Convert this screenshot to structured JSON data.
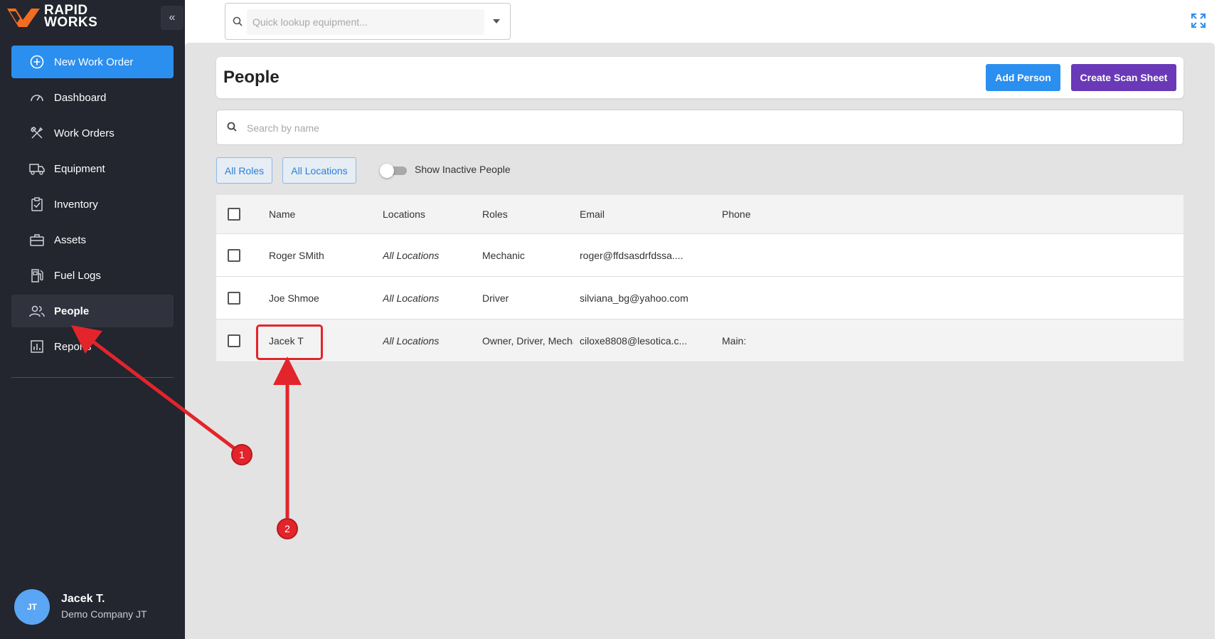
{
  "brand": {
    "line1": "RAPID",
    "line2": "WORKS",
    "accent": "#f26d21"
  },
  "sidebar": {
    "collapse_icon": "«",
    "new_work_order": "New Work Order",
    "items": [
      {
        "label": "Dashboard",
        "icon": "gauge-icon"
      },
      {
        "label": "Work Orders",
        "icon": "tools-icon"
      },
      {
        "label": "Equipment",
        "icon": "truck-icon"
      },
      {
        "label": "Inventory",
        "icon": "clipboard-check-icon"
      },
      {
        "label": "Assets",
        "icon": "briefcase-icon"
      },
      {
        "label": "Fuel Logs",
        "icon": "fuel-pump-icon"
      },
      {
        "label": "People",
        "icon": "people-icon",
        "active": true
      },
      {
        "label": "Reports",
        "icon": "chart-icon"
      }
    ],
    "user": {
      "initials": "JT",
      "name": "Jacek T.",
      "company": "Demo Company JT"
    }
  },
  "topbar": {
    "lookup_placeholder": "Quick lookup equipment..."
  },
  "page": {
    "title": "People",
    "add_person": "Add Person",
    "create_scan_sheet": "Create Scan Sheet",
    "search_placeholder": "Search by name",
    "filters": {
      "roles": "All Roles",
      "locations": "All Locations",
      "show_inactive": "Show Inactive People",
      "show_inactive_on": false
    }
  },
  "table": {
    "columns": [
      "Name",
      "Locations",
      "Roles",
      "Email",
      "Phone"
    ],
    "rows": [
      {
        "name": "Roger SMith",
        "locations": "All Locations",
        "roles": "Mechanic",
        "email": "roger@ffdsasdrfdssa....",
        "phone": ""
      },
      {
        "name": "Joe Shmoe",
        "locations": "All Locations",
        "roles": "Driver",
        "email": "silviana_bg@yahoo.com",
        "phone": ""
      },
      {
        "name": "Jacek T",
        "locations": "All Locations",
        "roles": "Owner, Driver, Mecha",
        "email": "ciloxe8808@lesotica.c...",
        "phone": "Main:"
      }
    ]
  },
  "annotations": {
    "step1": "1",
    "step2": "2",
    "color": "#e3242b"
  },
  "colors": {
    "primary": "#2b8ff0",
    "purple": "#6a39b8",
    "sidebar_bg": "#23252f"
  }
}
